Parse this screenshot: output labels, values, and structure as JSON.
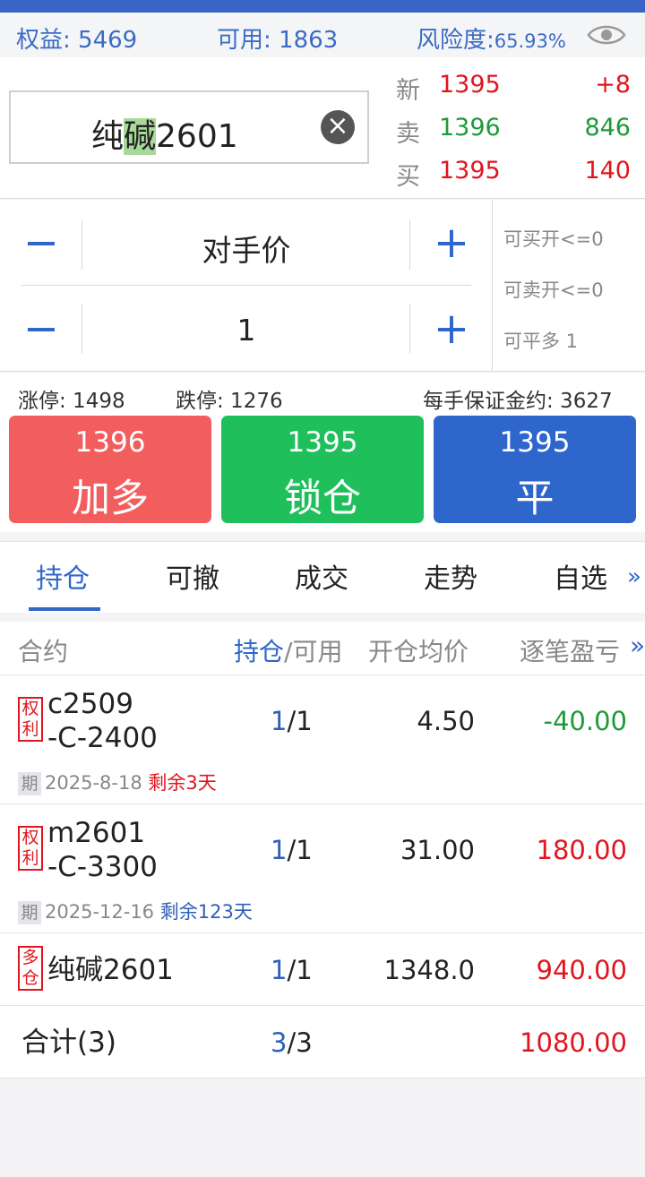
{
  "colors": {
    "accent": "#2f66c9",
    "red": "#e0161f",
    "green": "#1f9a3a",
    "btn_add": "#f25e5e",
    "btn_lock": "#1fbf5c",
    "btn_close": "#2f66cc"
  },
  "account": {
    "equity_label": "权益:",
    "equity": "5469",
    "available_label": "可用:",
    "available": "1863",
    "risk_label": "风险度:",
    "risk": "65.93%"
  },
  "symbol": {
    "prefix": "纯",
    "highlight": "碱",
    "suffix": "2601"
  },
  "quote": {
    "last_label": "新",
    "last_price": "1395",
    "last_change": "+8",
    "ask_label": "卖",
    "ask_price": "1396",
    "ask_volume": "846",
    "bid_label": "买",
    "bid_price": "1395",
    "bid_volume": "140"
  },
  "order": {
    "price_type": "对手价",
    "quantity": "1",
    "can_buy_open": "可买开<=0",
    "can_sell_open": "可卖开<=0",
    "can_close_long": "可平多 1"
  },
  "limits": {
    "limit_up": "涨停: 1498",
    "limit_down": "跌停: 1276",
    "margin_per_lot": "每手保证金约: 3627"
  },
  "trade_buttons": [
    {
      "price": "1396",
      "action": "加多"
    },
    {
      "price": "1395",
      "action": "锁仓"
    },
    {
      "price": "1395",
      "action": "平"
    }
  ],
  "tabs": [
    "持仓",
    "可撤",
    "成交",
    "走势",
    "自选"
  ],
  "table": {
    "col_contract": "合约",
    "col_position": "持仓",
    "col_sep_available": "/可用",
    "col_avg_price": "开仓均价",
    "col_pnl": "逐笔盈亏",
    "rows": [
      {
        "tag": [
          "权",
          "利"
        ],
        "name_line1": "c2509",
        "name_line2": "-C-2400",
        "position": "1",
        "available": "/1",
        "avg_price": "4.50",
        "pnl": "-40.00",
        "exp_icon": "期",
        "exp_date": "2025-8-18",
        "remaining": "剩余3天"
      },
      {
        "tag": [
          "权",
          "利"
        ],
        "name_line1": "m2601",
        "name_line2": "-C-3300",
        "position": "1",
        "available": "/1",
        "avg_price": "31.00",
        "pnl": "180.00",
        "exp_icon": "期",
        "exp_date": "2025-12-16",
        "remaining": "剩余123天"
      },
      {
        "tag": [
          "多",
          "仓"
        ],
        "name_line1": "纯碱2601",
        "position": "1",
        "available": "/1",
        "avg_price": "1348.0",
        "pnl": "940.00"
      }
    ],
    "total_label": "合计(3)",
    "total_position": "3",
    "total_available": "/3",
    "total_pnl": "1080.00"
  }
}
